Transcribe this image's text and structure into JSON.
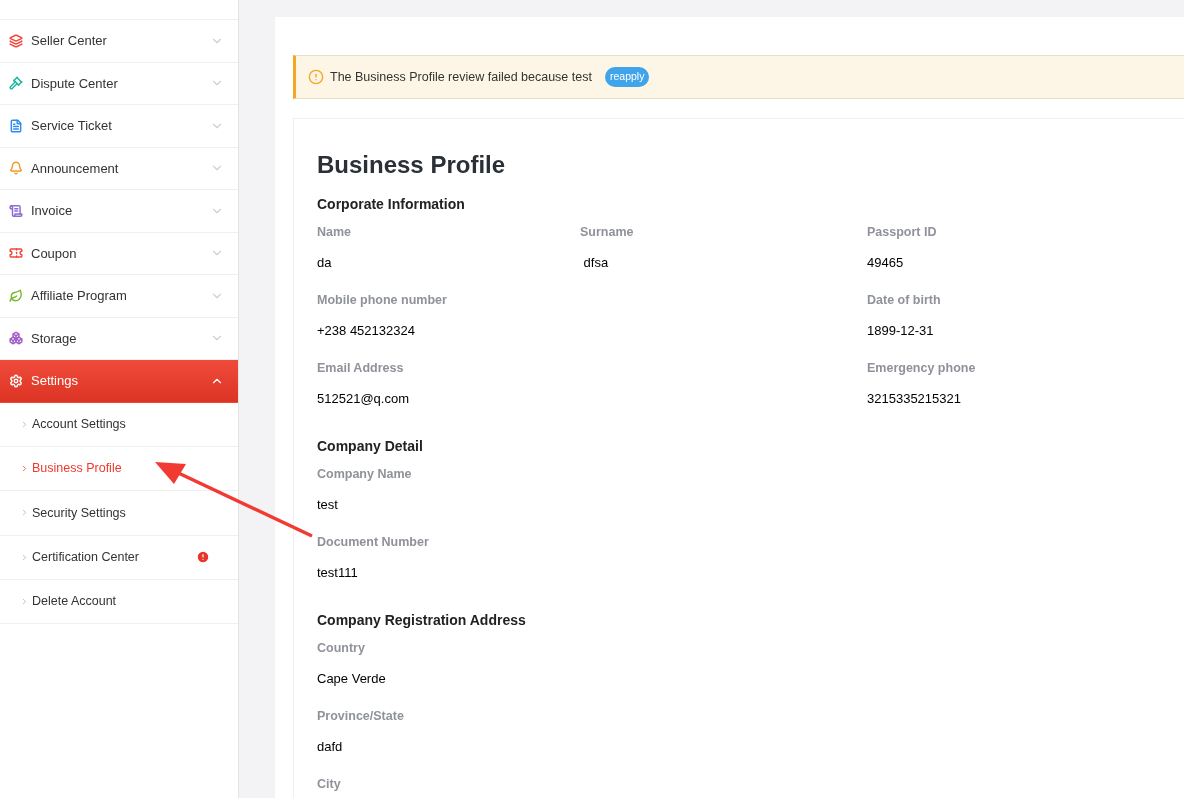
{
  "sidebar": {
    "items": [
      {
        "kind": "layers",
        "label": "Seller Center",
        "expanded": false
      },
      {
        "kind": "gavel",
        "label": "Dispute Center",
        "expanded": false
      },
      {
        "kind": "ticket-doc",
        "label": "Service Ticket",
        "expanded": false
      },
      {
        "kind": "bell",
        "label": "Announcement",
        "expanded": false
      },
      {
        "kind": "scroll",
        "label": "Invoice",
        "expanded": false
      },
      {
        "kind": "coupon",
        "label": "Coupon",
        "expanded": false
      },
      {
        "kind": "leaf",
        "label": "Affiliate Program",
        "expanded": false
      },
      {
        "kind": "boxes",
        "label": "Storage",
        "expanded": false
      },
      {
        "kind": "gear",
        "label": "Settings",
        "expanded": true,
        "children": [
          {
            "label": "Account Settings",
            "selected": false,
            "alert": false
          },
          {
            "label": "Business Profile",
            "selected": true,
            "alert": false
          },
          {
            "label": "Security Settings",
            "selected": false,
            "alert": false
          },
          {
            "label": "Certification Center",
            "selected": false,
            "alert": true
          },
          {
            "label": "Delete Account",
            "selected": false,
            "alert": false
          }
        ]
      }
    ]
  },
  "notice": {
    "message": "The Business Profile review failed because test",
    "action": "reapply"
  },
  "profile": {
    "title": "Business Profile",
    "sections": [
      {
        "heading": "Corporate Information",
        "rows": [
          [
            {
              "kind": "field",
              "label": "Name",
              "value": "da"
            },
            {
              "kind": "field",
              "label": "Surname",
              "value": " dfsa"
            },
            {
              "kind": "field",
              "label": "Passport ID",
              "value": "49465"
            }
          ],
          [
            {
              "kind": "field",
              "label": "Mobile phone number",
              "value": "+238 452132324"
            },
            {
              "kind": "empty"
            },
            {
              "kind": "field",
              "label": "Date of birth",
              "value": "1899-12-31"
            }
          ],
          [
            {
              "kind": "field",
              "label": "Email Address",
              "value": "512521@q.com"
            },
            {
              "kind": "empty"
            },
            {
              "kind": "field",
              "label": "Emergency phone",
              "value": "3215335215321"
            }
          ]
        ]
      },
      {
        "heading": "Company Detail",
        "rows": [
          [
            {
              "kind": "field",
              "label": "Company Name",
              "value": "test"
            }
          ],
          [
            {
              "kind": "field",
              "label": "Document Number",
              "value": "test111"
            }
          ]
        ]
      },
      {
        "heading": "Company Registration Address",
        "rows": [
          [
            {
              "kind": "field",
              "label": "Country",
              "value": "Cape Verde"
            }
          ],
          [
            {
              "kind": "field",
              "label": "Province/State",
              "value": "dafd"
            }
          ],
          [
            {
              "kind": "field",
              "label": "City"
            }
          ]
        ]
      }
    ]
  }
}
